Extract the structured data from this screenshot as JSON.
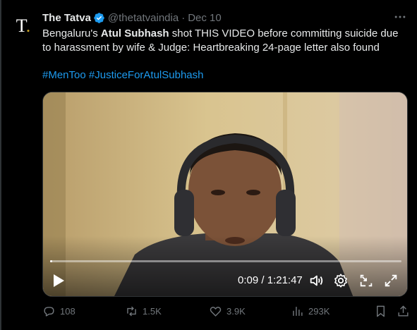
{
  "tweet": {
    "avatar_letter": "T",
    "author_name": "The Tatva",
    "handle": "@thetatvaindia",
    "separator": "·",
    "date": "Dec 10",
    "text_part1": "Bengaluru's ",
    "text_bold": "Atul Subhash",
    "text_part2": " shot THIS VIDEO before committing suicide due to harassment by wife & Judge: Heartbreaking 24-page letter also found",
    "hashtag1": "#MenToo",
    "hashtag2": "#JusticeForAtulSubhash"
  },
  "video": {
    "current_time": "0:09",
    "time_separator": " / ",
    "duration": "1:21:47",
    "progress_fraction": 0.002
  },
  "actions": {
    "replies": "108",
    "reposts": "1.5K",
    "likes": "3.9K",
    "views": "293K"
  },
  "colors": {
    "accent": "#1d9bf0",
    "muted": "#71767b",
    "text": "#e7e9ea",
    "background": "#000000"
  },
  "icons": [
    "verified-badge-icon",
    "more-icon",
    "play-icon",
    "volume-icon",
    "settings-icon",
    "pip-icon",
    "fullscreen-icon",
    "reply-icon",
    "repost-icon",
    "like-icon",
    "views-icon",
    "bookmark-icon",
    "share-icon"
  ]
}
